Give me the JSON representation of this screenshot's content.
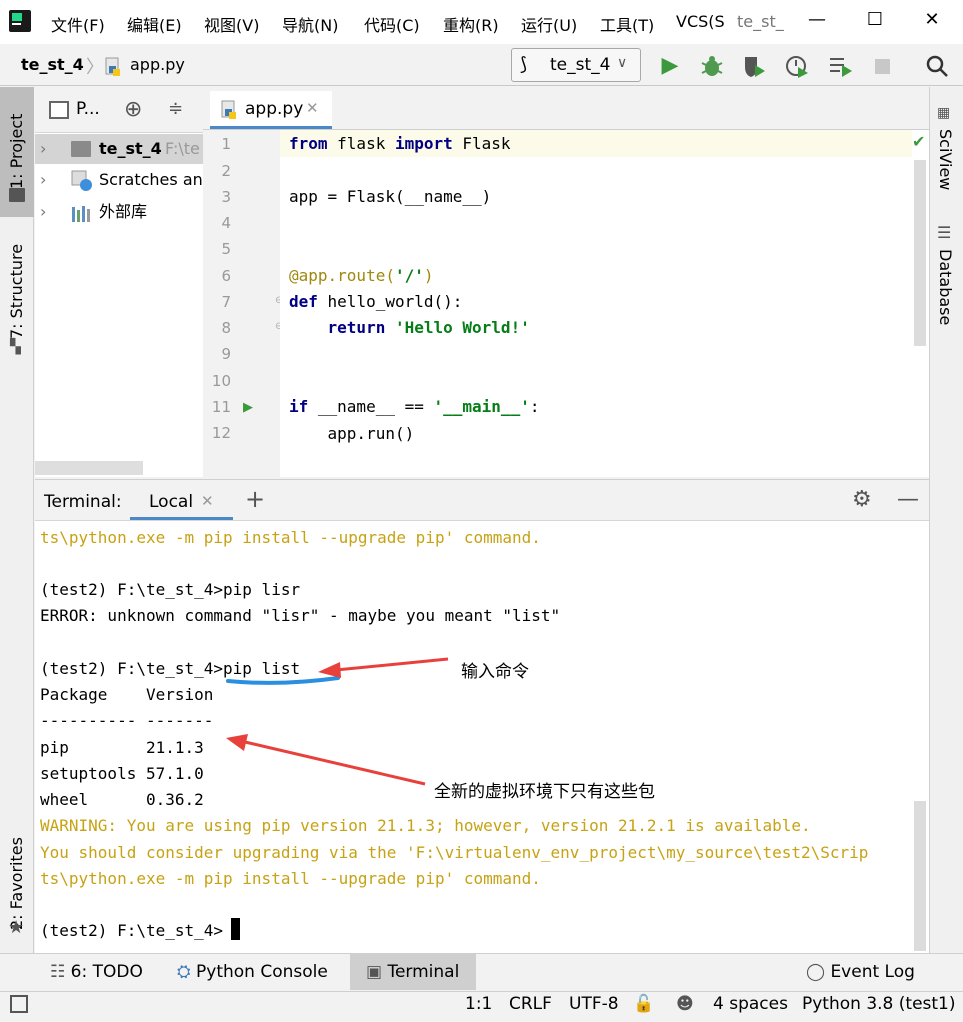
{
  "menu": [
    "文件(F)",
    "编辑(E)",
    "视图(V)",
    "导航(N)",
    "代码(C)",
    "重构(R)",
    "运行(U)",
    "工具(T)",
    "VCS(S",
    "te_st_"
  ],
  "window_controls": {
    "minimize": "—",
    "maximize": "☐",
    "close": "✕"
  },
  "breadcrumb": {
    "project": "te_st_4",
    "file": "app.py"
  },
  "run_config": {
    "name": "te_st_4"
  },
  "left_stripe": {
    "project": "1: Project",
    "structure": "7: Structure",
    "favorites": "2: Favorites"
  },
  "right_stripe": {
    "sciview": "SciView",
    "database": "Database"
  },
  "project_panel": {
    "selector": "P...",
    "tree": [
      {
        "label": "te_st_4",
        "hint": "F:\\te"
      },
      {
        "label": "Scratches and"
      },
      {
        "label": "外部库"
      }
    ]
  },
  "editor": {
    "tab": "app.py",
    "lines": [
      "1",
      "2",
      "3",
      "4",
      "5",
      "6",
      "7",
      "8",
      "9",
      "10",
      "11",
      "12"
    ]
  },
  "terminal": {
    "title": "Terminal:",
    "tab": "Local",
    "lines": [
      "ts\\python.exe -m pip install --upgrade pip' command.",
      "",
      "(test2) F:\\te_st_4>pip lisr",
      "ERROR: unknown command \"lisr\" - maybe you meant \"list\"",
      "",
      "(test2) F:\\te_st_4>pip list",
      "Package    Version",
      "---------- -------",
      "pip        21.1.3",
      "setuptools 57.1.0",
      "wheel      0.36.2",
      "WARNING: You are using pip version 21.1.3; however, version 21.2.1 is available.",
      "You should consider upgrading via the 'F:\\virtualenv_env_project\\my_source\\test2\\Scrip",
      "ts\\python.exe -m pip install --upgrade pip' command.",
      "",
      "(test2) F:\\te_st_4>"
    ]
  },
  "annotations": {
    "command": "输入命令",
    "packages": "全新的虚拟环境下只有这些包",
    "arrow_color": "#e8413c",
    "underline_color": "#2a8fe0"
  },
  "bottom_tabs": {
    "todo": "6: TODO",
    "python_console": "Python Console",
    "terminal": "Terminal",
    "event_log": "Event Log"
  },
  "status": {
    "position": "1:1",
    "line_sep": "CRLF",
    "encoding": "UTF-8",
    "indent": "4 spaces",
    "interpreter": "Python 3.8 (test1)"
  }
}
